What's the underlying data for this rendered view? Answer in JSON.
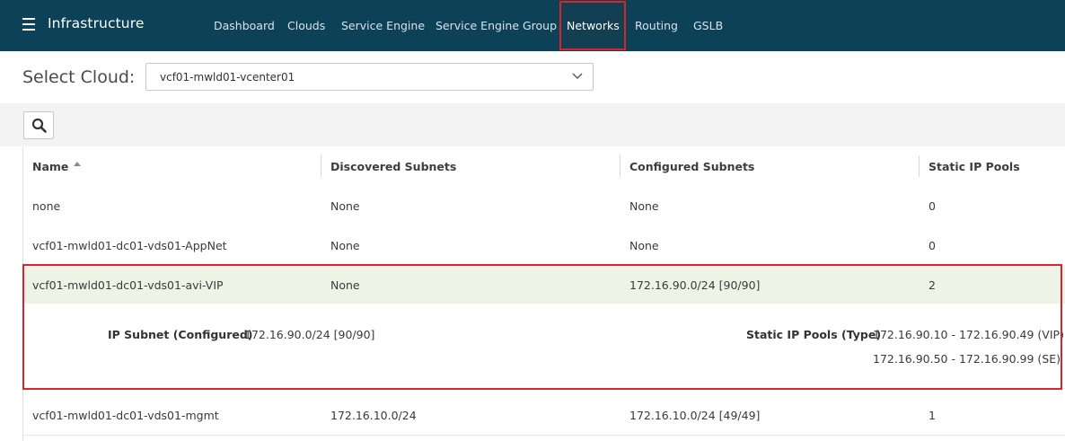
{
  "header": {
    "app_title": "Infrastructure",
    "nav": [
      {
        "label": "Dashboard"
      },
      {
        "label": "Clouds"
      },
      {
        "label": "Service Engine"
      },
      {
        "label": "Service Engine Group"
      },
      {
        "label": "Networks",
        "active": true
      },
      {
        "label": "Routing"
      },
      {
        "label": "GSLB"
      }
    ]
  },
  "cloud_selector": {
    "label": "Select Cloud:",
    "value": "vcf01-mwld01-vcenter01"
  },
  "table": {
    "columns": [
      "Name",
      "Discovered Subnets",
      "Configured Subnets",
      "Static IP Pools"
    ],
    "rows": [
      {
        "name": "none",
        "discovered": "None",
        "configured": "None",
        "pools": "0"
      },
      {
        "name": "vcf01-mwld01-dc01-vds01-AppNet",
        "discovered": "None",
        "configured": "None",
        "pools": "0"
      },
      {
        "name": "vcf01-mwld01-dc01-vds01-avi-VIP",
        "discovered": "None",
        "configured": "172.16.90.0/24 [90/90]",
        "pools": "2"
      },
      {
        "name": "vcf01-mwld01-dc01-vds01-mgmt",
        "discovered": "172.16.10.0/24",
        "configured": "172.16.10.0/24 [49/49]",
        "pools": "1"
      }
    ],
    "expanded": {
      "subnet_label": "IP Subnet (Configured)",
      "subnet_value": "172.16.90.0/24 [90/90]",
      "pools_label": "Static IP Pools (Type)",
      "pool_1": "172.16.90.10 - 172.16.90.49 (VIP)",
      "pool_2": "172.16.90.50 - 172.16.90.99 (SE)"
    }
  },
  "colors": {
    "topbar": "#0d4157",
    "highlight": "#d9232e",
    "selected_row": "#eef3e6"
  }
}
